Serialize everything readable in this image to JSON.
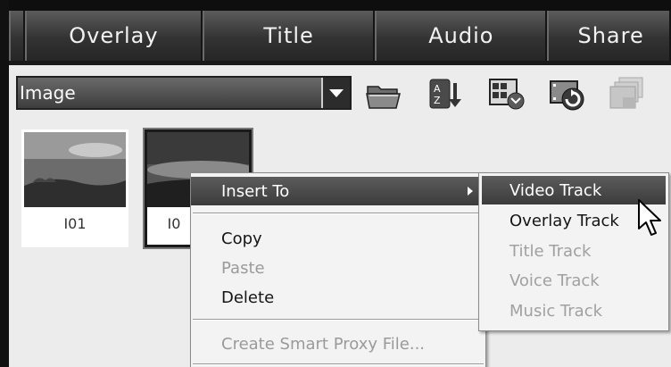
{
  "tabs": [
    {
      "label": ""
    },
    {
      "label": "Overlay"
    },
    {
      "label": "Title"
    },
    {
      "label": "Audio"
    },
    {
      "label": "Share"
    }
  ],
  "library": {
    "dropdown": {
      "value": "Image"
    },
    "toolbar": [
      {
        "icon": "folder-icon"
      },
      {
        "icon": "sort-az-icon"
      },
      {
        "icon": "view-options-icon"
      },
      {
        "icon": "capture-video-icon"
      },
      {
        "icon": "library-manager-icon"
      }
    ],
    "thumbnails": [
      {
        "label": "I01",
        "selected": false
      },
      {
        "label": "I0",
        "selected": true
      }
    ]
  },
  "context_menu": {
    "items": [
      {
        "label": "Insert To",
        "state": "highlighted",
        "has_submenu": true
      },
      {
        "label": "Copy",
        "state": "enabled"
      },
      {
        "label": "Paste",
        "state": "disabled"
      },
      {
        "label": "Delete",
        "state": "enabled"
      },
      {
        "label": "Create Smart Proxy File...",
        "state": "disabled"
      }
    ]
  },
  "submenu": {
    "items": [
      {
        "label": "Video Track",
        "state": "highlighted"
      },
      {
        "label": "Overlay Track",
        "state": "enabled"
      },
      {
        "label": "Title Track",
        "state": "disabled"
      },
      {
        "label": "Voice Track",
        "state": "disabled"
      },
      {
        "label": "Music Track",
        "state": "disabled"
      }
    ]
  }
}
